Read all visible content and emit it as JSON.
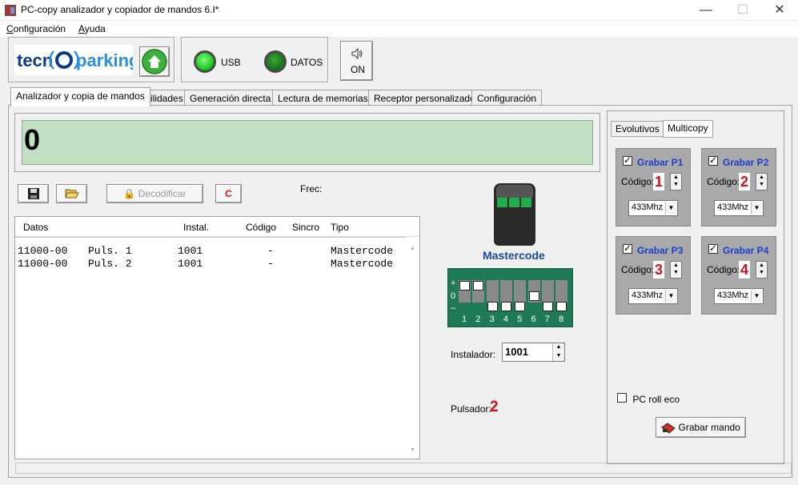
{
  "window": {
    "title": "PC-copy analizador y copiador de mandos 6.I*",
    "minimize": "—",
    "maximize": "☐",
    "close": "✕"
  },
  "menu": [
    {
      "underline": "C",
      "rest": "onfiguración"
    },
    {
      "underline": "A",
      "rest": "yuda"
    }
  ],
  "logo": {
    "part1": "tecn",
    "part2": "parking"
  },
  "status": {
    "usb_label": "USB",
    "datos_label": "DATOS",
    "usb_state": "on",
    "datos_state": "dim"
  },
  "sound": {
    "label": "ON",
    "icon": "speaker-icon"
  },
  "tabs": [
    "Analizador y copia de mandos",
    "Utilidades",
    "Generación directa",
    "Lectura de memorias",
    "Receptor personalizado",
    "Configuración"
  ],
  "display": {
    "value": "0"
  },
  "toolbar": {
    "decode_label": "Decodificar",
    "c_label": "C",
    "frec_label": "Frec:"
  },
  "list": {
    "columns": [
      "Datos",
      "Instal.",
      "Código",
      "Sincro",
      "Tipo"
    ],
    "rows": [
      {
        "datos": "11000-00",
        "puls": "Puls. 1",
        "instal": "1001",
        "codigo": "-",
        "sincro": "",
        "tipo": "Mastercode"
      },
      {
        "datos": "11000-00",
        "puls": "Puls. 2",
        "instal": "1001",
        "codigo": "-",
        "sincro": "",
        "tipo": "Mastercode"
      }
    ]
  },
  "remote": {
    "name": "Mastercode"
  },
  "dip": {
    "signs": [
      "+",
      "0",
      "–"
    ],
    "switch_numbers": [
      "1",
      "2",
      "3",
      "4",
      "5",
      "6",
      "7",
      "8"
    ],
    "positions": [
      "+",
      "+",
      "-",
      "-",
      "-",
      "0",
      "-",
      "-"
    ]
  },
  "installer": {
    "label": "Instalador:",
    "value": "1001"
  },
  "pulsador": {
    "label": "Pulsador:",
    "value": "2"
  },
  "right_panel": {
    "subtabs": [
      "Evolutivos",
      "Multicopy"
    ],
    "groups": [
      {
        "title": "Grabar P1",
        "code_label": "Código:",
        "code": "1",
        "freq": "433Mhz",
        "checked": true
      },
      {
        "title": "Grabar P2",
        "code_label": "Código:",
        "code": "2",
        "freq": "433Mhz",
        "checked": true
      },
      {
        "title": "Grabar P3",
        "code_label": "Código:",
        "code": "3",
        "freq": "433Mhz",
        "checked": true
      },
      {
        "title": "Grabar P4",
        "code_label": "Código:",
        "code": "4",
        "freq": "433Mhz",
        "checked": true
      }
    ],
    "pc_roll_label": "PC roll eco",
    "grabar_mando_label": "Grabar mando"
  }
}
